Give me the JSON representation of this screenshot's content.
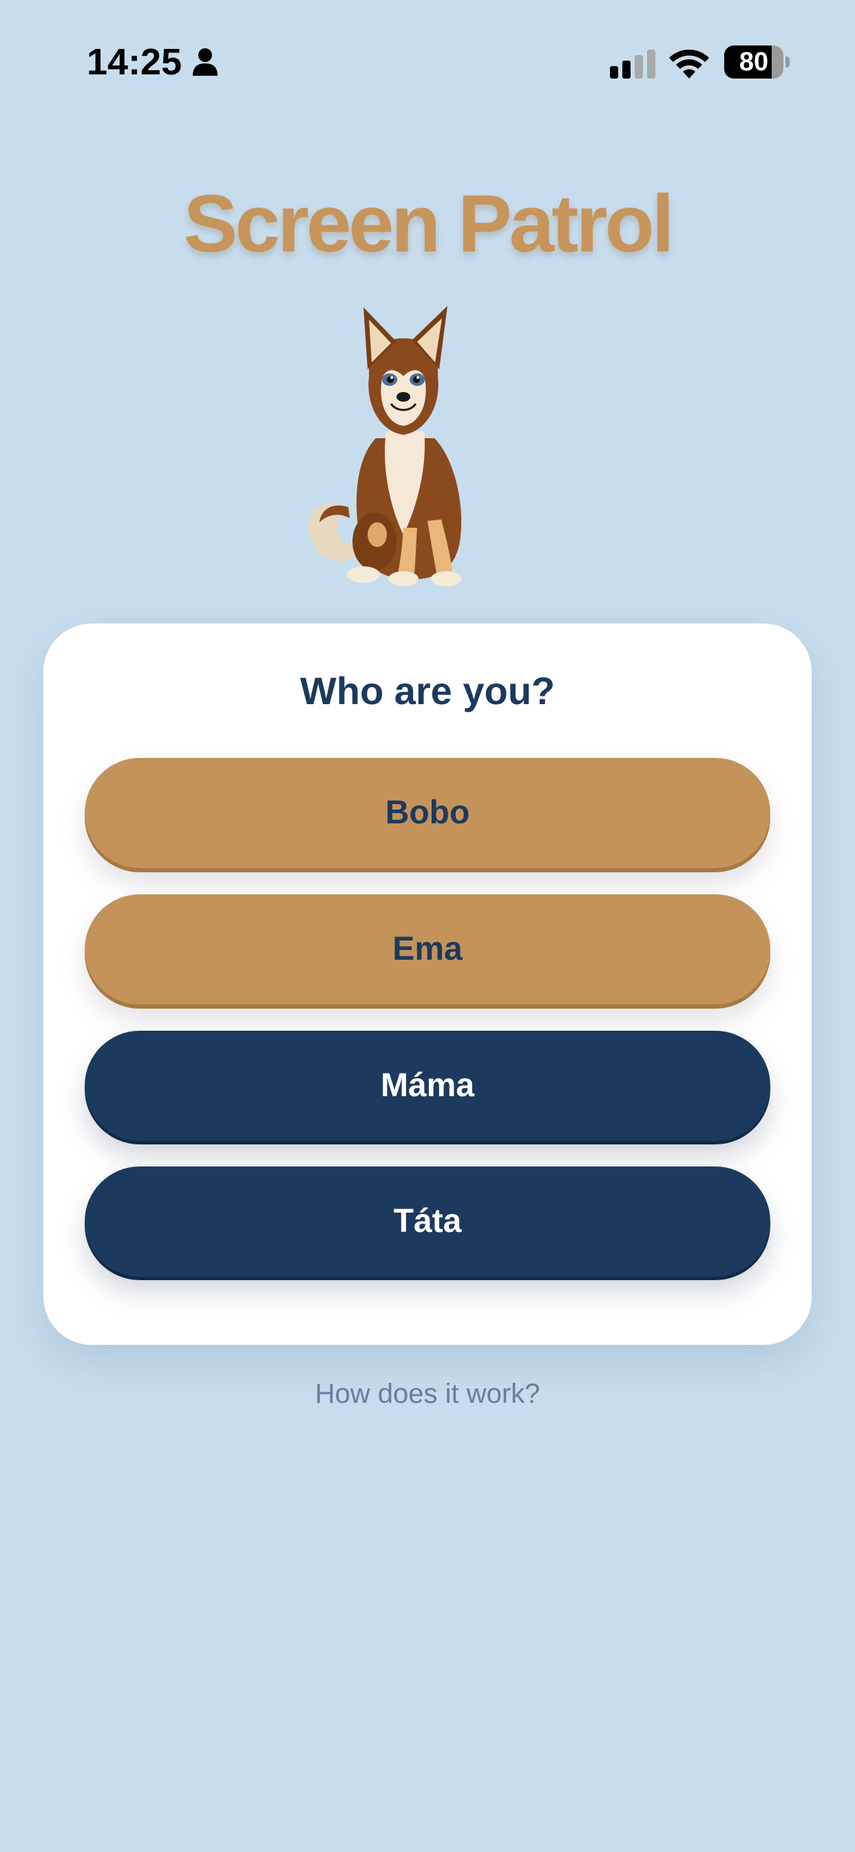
{
  "status_bar": {
    "time": "14:25",
    "battery_level": "80",
    "battery_fraction": 0.8,
    "icons": [
      "person-icon",
      "cellular-signal-icon",
      "wifi-icon",
      "battery-icon"
    ]
  },
  "app": {
    "title": "Screen Patrol",
    "mascot": "dog-mascot-illustration"
  },
  "card": {
    "heading": "Who are you?",
    "users": [
      {
        "label": "Bobo",
        "role": "child"
      },
      {
        "label": "Ema",
        "role": "child"
      },
      {
        "label": "Máma",
        "role": "parent"
      },
      {
        "label": "Táta",
        "role": "parent"
      }
    ]
  },
  "footer": {
    "how_it_works": "How does it work?"
  },
  "colors": {
    "background": "#c7ddee",
    "brand_tan": "#c4935a",
    "navy": "#1c3a5e",
    "link": "#64809e"
  }
}
